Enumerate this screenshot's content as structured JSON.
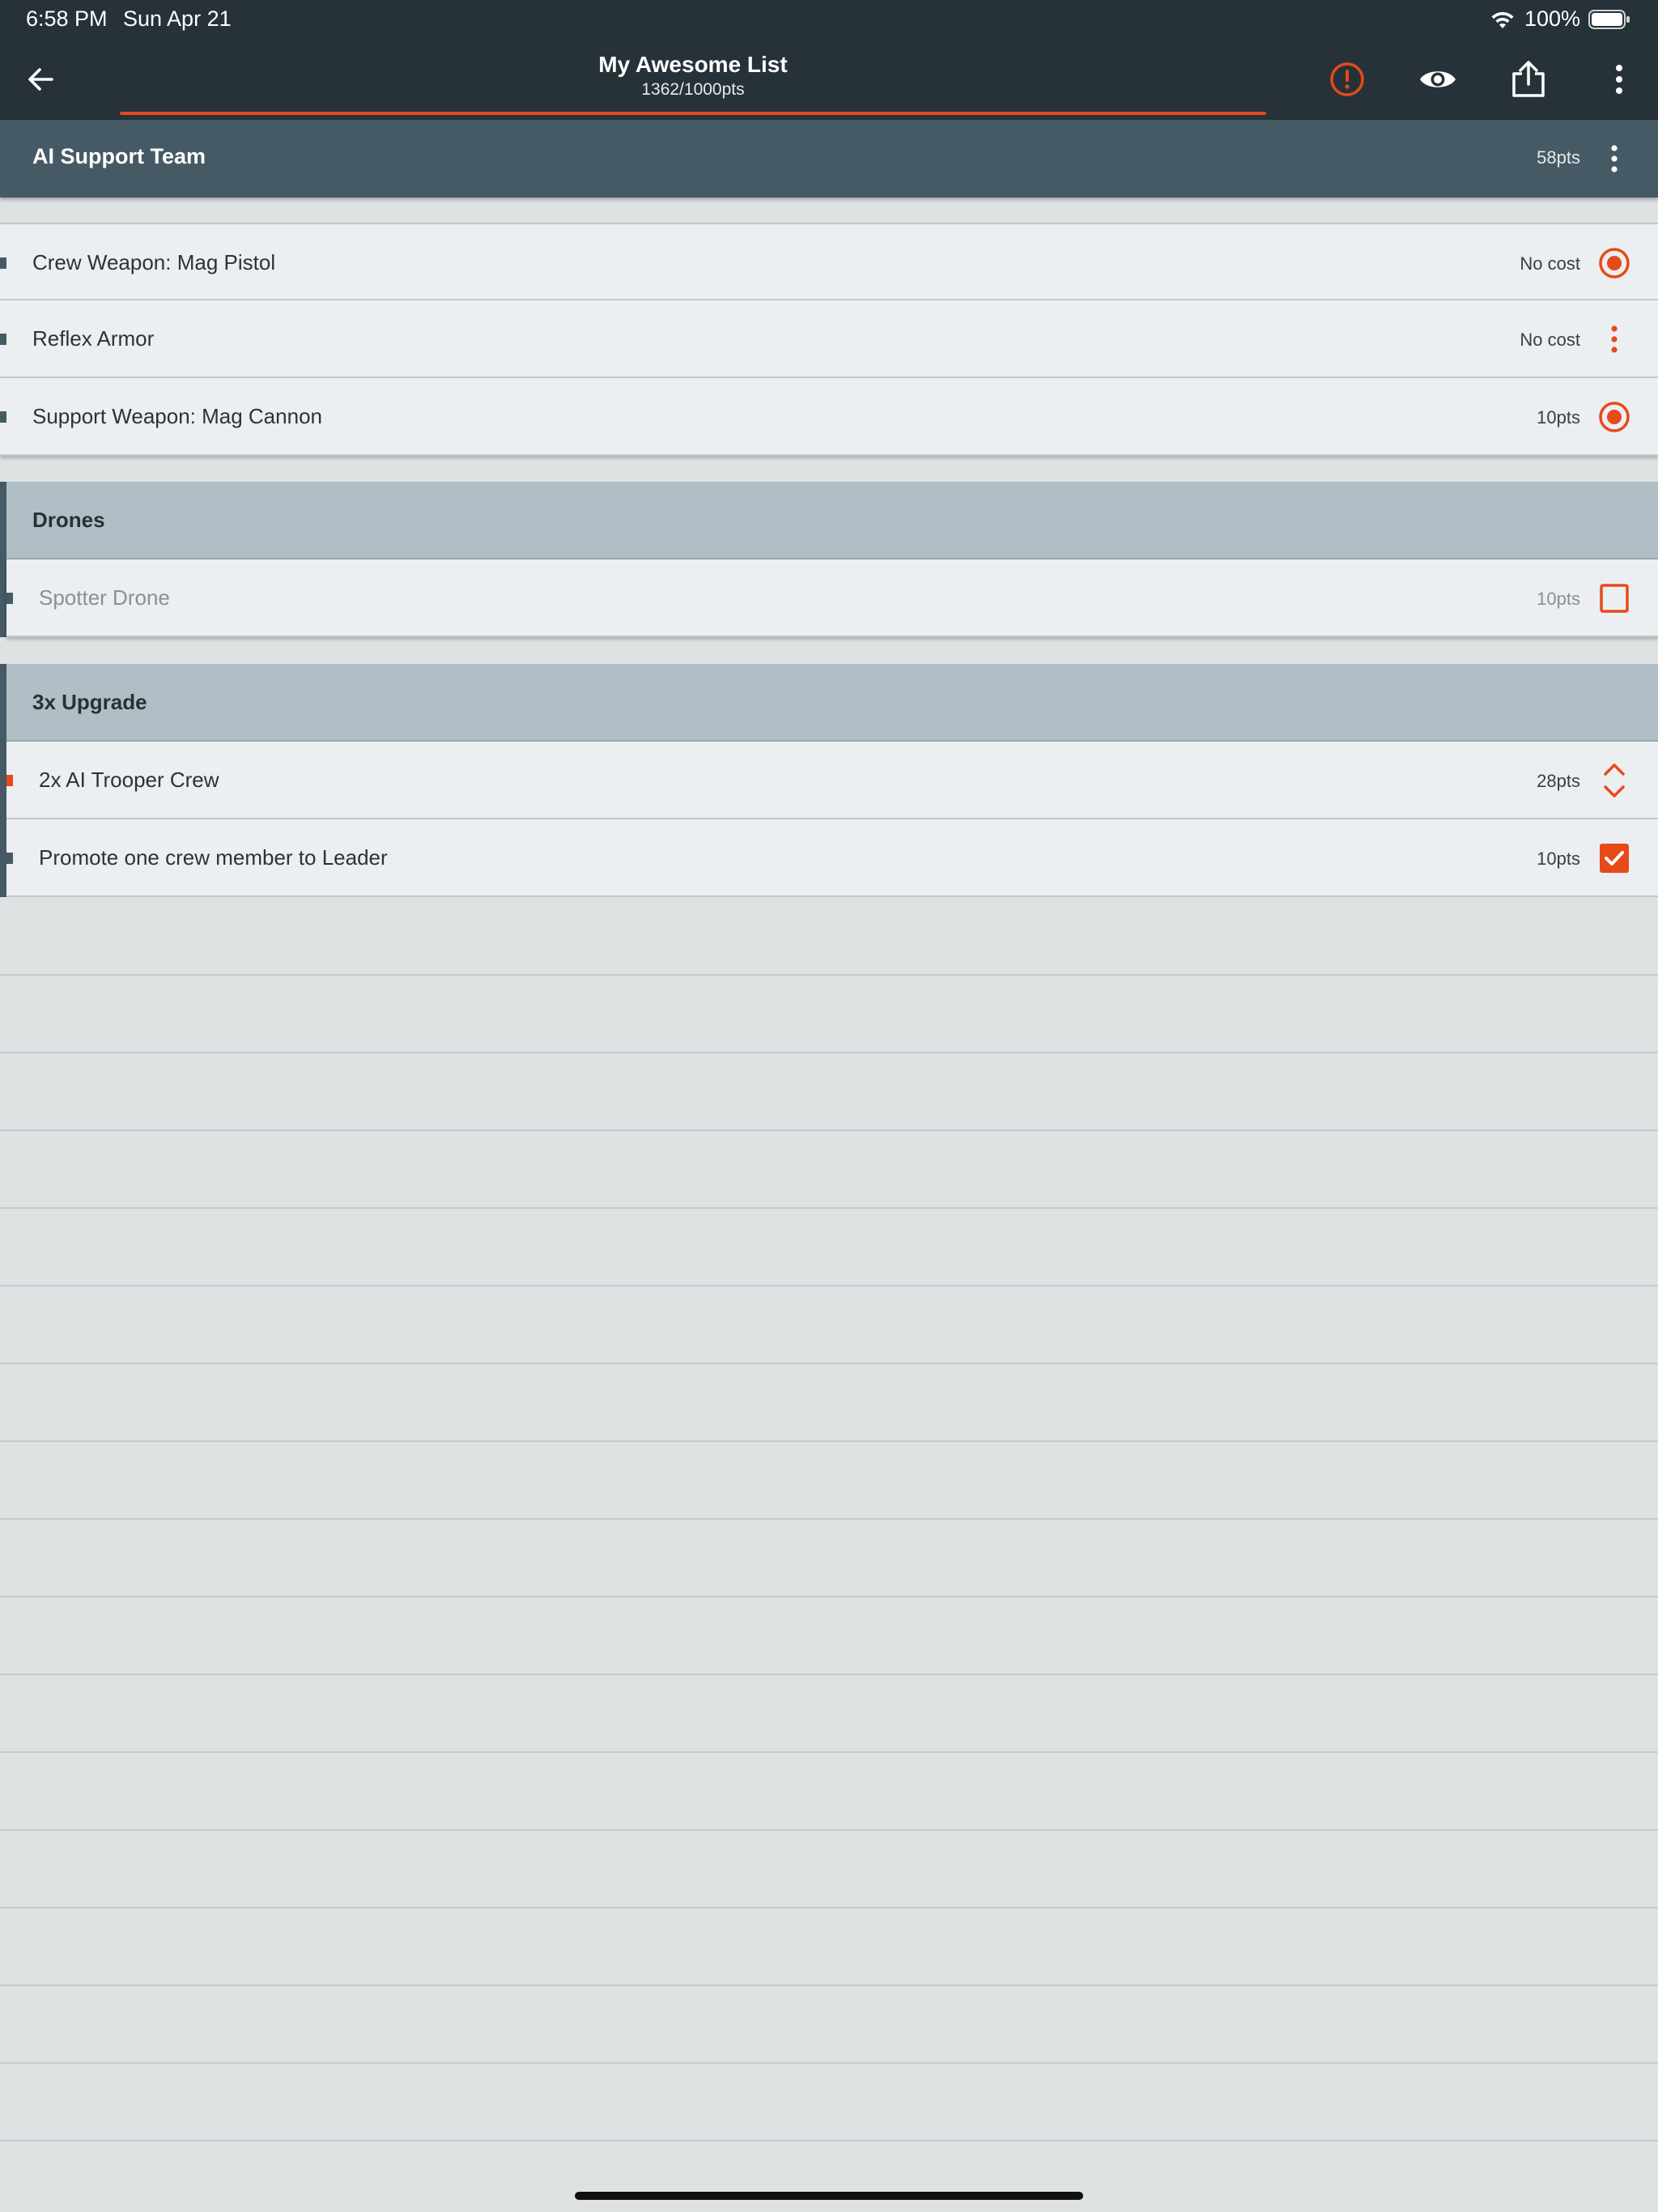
{
  "status": {
    "time": "6:58 PM",
    "date": "Sun Apr 21",
    "battery": "100%"
  },
  "appbar": {
    "title": "My Awesome List",
    "points": "1362/1000pts",
    "icons": [
      "back-arrow-icon",
      "warning-icon",
      "eye-icon",
      "share-icon",
      "more-vert-icon"
    ],
    "accent": "#e64a19"
  },
  "unit": {
    "name": "AI Support Team",
    "points": "58pts",
    "items": [
      {
        "label": "Crew Weapon: Mag Pistol",
        "cost": "No cost",
        "control": "radio-selected"
      },
      {
        "label": "Reflex Armor",
        "cost": "No cost",
        "control": "more-vert"
      },
      {
        "label": "Support Weapon: Mag Cannon",
        "cost": "10pts",
        "control": "radio-selected"
      }
    ]
  },
  "groups": [
    {
      "name": "Drones",
      "items": [
        {
          "label": "Spotter Drone",
          "cost": "10pts",
          "control": "checkbox-unchecked",
          "disabled": true
        }
      ]
    },
    {
      "name": "3x Upgrade",
      "items": [
        {
          "label": "2x AI Trooper Crew",
          "cost": "28pts",
          "control": "stepper"
        },
        {
          "label": "Promote one crew member to Leader",
          "cost": "10pts",
          "control": "checkbox-checked"
        }
      ]
    }
  ],
  "colors": {
    "appbar": "#263238",
    "unit_header": "#455a64",
    "group_header": "#b0bec5",
    "row": "#eceff1",
    "accent": "#e64a19"
  }
}
